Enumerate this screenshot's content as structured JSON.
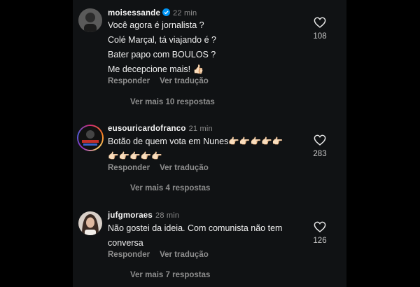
{
  "comments": [
    {
      "username": "moisessande",
      "time": "22 min",
      "verified": true,
      "lines": [
        "Você agora é jornalista ?",
        "Colé Marçal, tá viajando é ?",
        "Bater papo com BOULOS ?",
        "Me decepcione mais! 👍🏻"
      ],
      "likes": "108",
      "reply_label": "Responder",
      "translate_label": "Ver tradução",
      "more_replies": "Ver mais 10 respostas"
    },
    {
      "username": "eusouricardofranco",
      "time": "21 min",
      "verified": false,
      "lines": [
        "Botão de quem vota em Nunes👉🏻👉🏻👉🏻👉🏻👉🏻",
        "👉🏻👉🏻👉🏻👉🏻👉🏻"
      ],
      "likes": "283",
      "reply_label": "Responder",
      "translate_label": "Ver tradução",
      "more_replies": "Ver mais 4 respostas"
    },
    {
      "username": "jufgmoraes",
      "time": "28 min",
      "verified": false,
      "lines": [
        "Não gostei da ideia. Com comunista não tem",
        "conversa"
      ],
      "likes": "126",
      "reply_label": "Responder",
      "translate_label": "Ver tradução",
      "more_replies": "Ver mais 7 respostas"
    }
  ],
  "colors": {
    "background": "#101214",
    "text": "#f0f0f0",
    "muted": "#8e8e8e",
    "verified": "#0095f6"
  }
}
